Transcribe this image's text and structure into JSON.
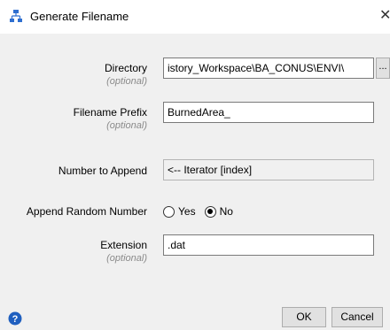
{
  "window": {
    "title": "Generate Filename",
    "close_glyph": "✕"
  },
  "form": {
    "directory": {
      "label": "Directory",
      "optional": "(optional)",
      "value": "istory_Workspace\\BA_CONUS\\ENVI\\",
      "browse_label": "..."
    },
    "prefix": {
      "label": "Filename Prefix",
      "optional": "(optional)",
      "value": "BurnedArea_"
    },
    "number": {
      "label": "Number to Append",
      "value": "<-- Iterator [index]"
    },
    "random": {
      "label": "Append Random Number",
      "options": [
        "Yes",
        "No"
      ],
      "selected": "No"
    },
    "extension": {
      "label": "Extension",
      "optional": "(optional)",
      "value": ".dat"
    }
  },
  "footer": {
    "ok_label": "OK",
    "cancel_label": "Cancel"
  },
  "icons": {
    "title": "model-flow-icon",
    "help": "help-icon",
    "help_color": "#1f5fbf"
  }
}
